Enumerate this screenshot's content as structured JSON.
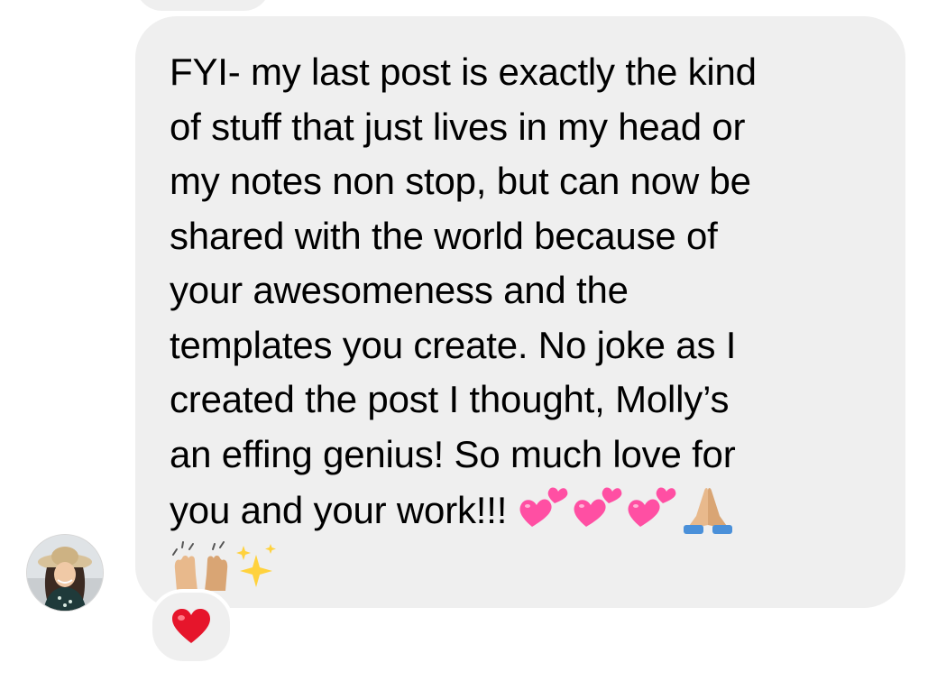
{
  "message": {
    "lines": [
      "FYI- my last post is exactly the kind",
      "of stuff that just lives in my head or",
      "my notes non stop, but can now be",
      "shared with the world because of",
      "your awesomeness and the",
      "templates you create. No joke as I",
      "created the post I thought, Molly’s",
      "an effing genius! So much love for",
      "you and your work!!! "
    ],
    "emojis_line9": [
      "two-hearts-icon",
      "two-hearts-icon",
      "two-hearts-icon",
      "folded-hands-icon"
    ],
    "emojis_line10": [
      "raising-hands-icon",
      "sparkles-icon"
    ]
  },
  "reaction": {
    "emoji": "red-heart-icon"
  },
  "colors": {
    "bubble": "#efefef",
    "text": "#000000",
    "heart_pink": "#ff4fa3",
    "heart_red": "#e6152b",
    "sparkle": "#ffd23d",
    "skin": "#e8b98c"
  }
}
